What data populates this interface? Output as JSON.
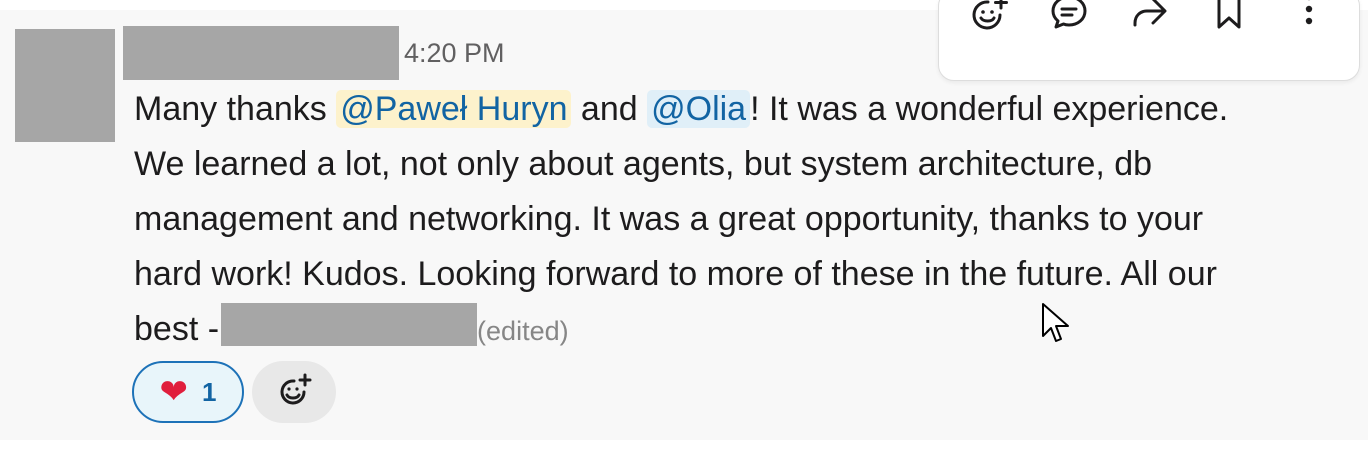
{
  "message": {
    "timestamp": "4:20 PM",
    "text": {
      "line1_before": "Many thanks ",
      "mention1": "@Paweł Huryn",
      "line1_mid": " and ",
      "mention2": "@Olia",
      "line1_after": "! It was a wonderful experience.",
      "line2": "We learned a lot, not only about agents, but system architecture, db",
      "line3": "management and networking.  It was a great opportunity, thanks to your",
      "line4": "hard work! Kudos. Looking forward to more of these in the future. All our",
      "line5_before": "best -"
    },
    "edited_label": "(edited)"
  },
  "reactions": [
    {
      "emoji": "heart",
      "symbol": "❤",
      "count": "1"
    }
  ],
  "toolbar": {
    "actions": [
      "add-reaction",
      "reply-in-thread",
      "share-message",
      "save-for-later",
      "more-actions"
    ]
  },
  "colors": {
    "mention_text": "#1264a3",
    "mention_bg": "#fdf2cc",
    "heart": "#e01e3c",
    "reaction_border": "#1d72b8"
  }
}
